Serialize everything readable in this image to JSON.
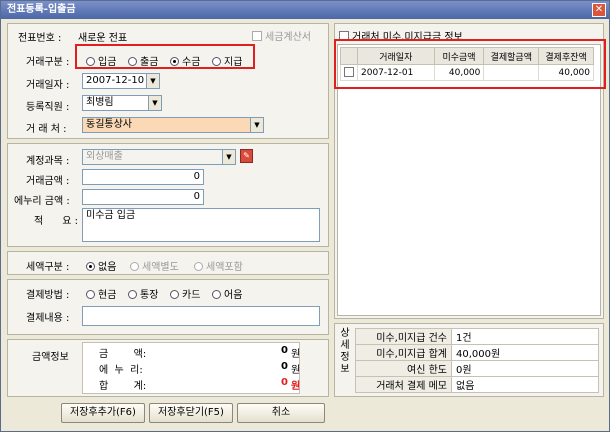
{
  "window": {
    "title": "전표등록-입출금",
    "close_icon": "close-icon"
  },
  "voucher": {
    "no_label": "전표번호 :",
    "no_value": "새로운 전표",
    "tax_invoice_label": "세금계산서",
    "type_label": "거래구분 :",
    "type_options": [
      "입금",
      "출금",
      "수금",
      "지급"
    ],
    "type_selected": "수금",
    "date_label": "거래일자 :",
    "date_value": "2007-12-10",
    "staff_label": "등록직원 :",
    "staff_value": "최병림",
    "client_label": "거 래 처 :",
    "client_value": "동길통상사"
  },
  "account": {
    "subject_label": "계정과목 :",
    "subject_value": "외상매출",
    "amount_label": "거래금액 :",
    "amount_value": "0",
    "enuri_label": "에누리 금액 :",
    "enuri_value": "0",
    "memo_label": "적      요 :",
    "memo_value": "미수금 입금"
  },
  "tax": {
    "label": "세액구분 :",
    "options": [
      "없음",
      "세액별도",
      "세액포함"
    ],
    "selected": "없음"
  },
  "payment": {
    "method_label": "결제방법 :",
    "methods": [
      "현금",
      "통장",
      "카드",
      "어음"
    ],
    "detail_label": "결제내용 :",
    "detail_value": ""
  },
  "amount_info": {
    "title": "금액정보",
    "rows": [
      {
        "label": "금        액:",
        "value": "0",
        "unit": "원",
        "color": "#000000"
      },
      {
        "label": "에  누  리:",
        "value": "0",
        "unit": "원",
        "color": "#000000"
      },
      {
        "label": "합        계:",
        "value": "0",
        "unit": "원",
        "color": "#e02020"
      }
    ]
  },
  "buttons": {
    "save_add": "저장후추가(F6)",
    "save_close": "저장후닫기(F5)",
    "cancel": "취소"
  },
  "receivable": {
    "title": "거래처 미수,미지급금 정보",
    "columns": [
      "거래일자",
      "미수금액",
      "결제할금액",
      "결제후잔액"
    ],
    "rows": [
      {
        "date": "2007-12-01",
        "unpaid": "40,000",
        "to_pay": "",
        "balance": "40,000"
      }
    ]
  },
  "summary": {
    "side_label": "상세정보",
    "rows": [
      {
        "key": "미수,미지급 건수",
        "value": "1건"
      },
      {
        "key": "미수,미지급 합계",
        "value": "40,000원"
      },
      {
        "key": "여신 한도",
        "value": "0원"
      },
      {
        "key": "거래처 결제 메모",
        "value": "없음"
      }
    ]
  }
}
